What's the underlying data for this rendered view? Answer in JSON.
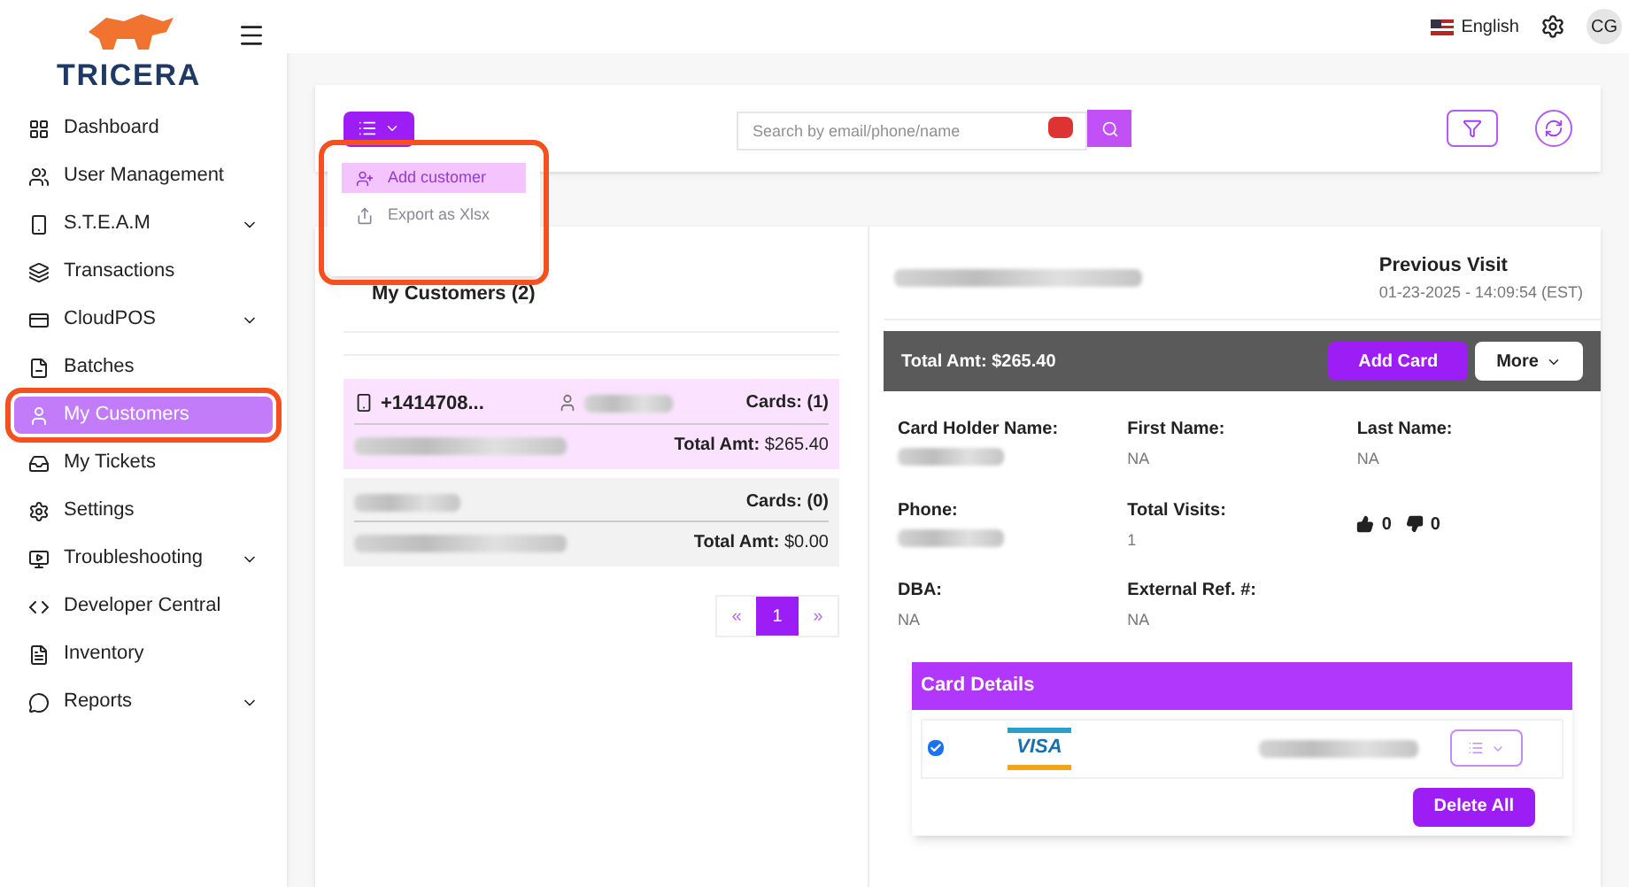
{
  "brand": {
    "name": "TRICERA"
  },
  "header": {
    "language": "English",
    "avatar": "CG"
  },
  "sidebar": {
    "items": [
      {
        "label": "Dashboard",
        "expandable": false,
        "selected": false
      },
      {
        "label": "User Management",
        "expandable": false,
        "selected": false
      },
      {
        "label": "S.T.E.A.M",
        "expandable": true,
        "selected": false
      },
      {
        "label": "Transactions",
        "expandable": false,
        "selected": false
      },
      {
        "label": "CloudPOS",
        "expandable": true,
        "selected": false
      },
      {
        "label": "Batches",
        "expandable": false,
        "selected": false
      },
      {
        "label": "My Customers",
        "expandable": false,
        "selected": true
      },
      {
        "label": "My Tickets",
        "expandable": false,
        "selected": false
      },
      {
        "label": "Settings",
        "expandable": false,
        "selected": false
      },
      {
        "label": "Troubleshooting",
        "expandable": true,
        "selected": false
      },
      {
        "label": "Developer Central",
        "expandable": false,
        "selected": false
      },
      {
        "label": "Inventory",
        "expandable": false,
        "selected": false
      },
      {
        "label": "Reports",
        "expandable": true,
        "selected": false
      }
    ]
  },
  "toolbar": {
    "search": {
      "placeholder": "Search by email/phone/name"
    },
    "menu": {
      "expanded": true,
      "items": [
        {
          "label": "Add customer",
          "selected": true
        },
        {
          "label": "Export as Xlsx",
          "selected": false
        }
      ]
    }
  },
  "customers": {
    "title": "My Customers (2)",
    "rows": [
      {
        "phone": "+1414708...",
        "cards": "Cards: (1)",
        "total_label": "Total Amt:",
        "total": "$265.40",
        "selected": true
      },
      {
        "cards": "Cards: (0)",
        "total_label": "Total Amt:",
        "total": "$0.00",
        "selected": false
      }
    ],
    "pagination": {
      "prev": "«",
      "pages": [
        {
          "label": "1",
          "selected": true
        }
      ],
      "next": "»"
    }
  },
  "detail": {
    "previous_visit_label": "Previous Visit",
    "previous_visit": "01-23-2025 - 14:09:54 (EST)",
    "total": "Total Amt: $265.40",
    "add_card": "Add Card",
    "more": "More",
    "fields": [
      {
        "label": "Card Holder Name:",
        "kind": "blurred"
      },
      {
        "label": "First Name:",
        "value": "NA",
        "kind": "text"
      },
      {
        "label": "Last Name:",
        "value": "NA",
        "kind": "text"
      },
      {
        "label": "Phone:",
        "kind": "blurred"
      },
      {
        "label": "Total Visits:",
        "value": "1",
        "kind": "text"
      },
      {
        "kind": "votes",
        "up": "0",
        "down": "0"
      },
      {
        "label": "DBA:",
        "value": "NA",
        "kind": "text"
      },
      {
        "label": "External Ref. #:",
        "value": "NA",
        "kind": "text"
      }
    ],
    "card_details": {
      "title": "Card Details",
      "cards": [
        {
          "brand": "VISA",
          "checked": true
        }
      ],
      "delete_all": "Delete All"
    }
  }
}
